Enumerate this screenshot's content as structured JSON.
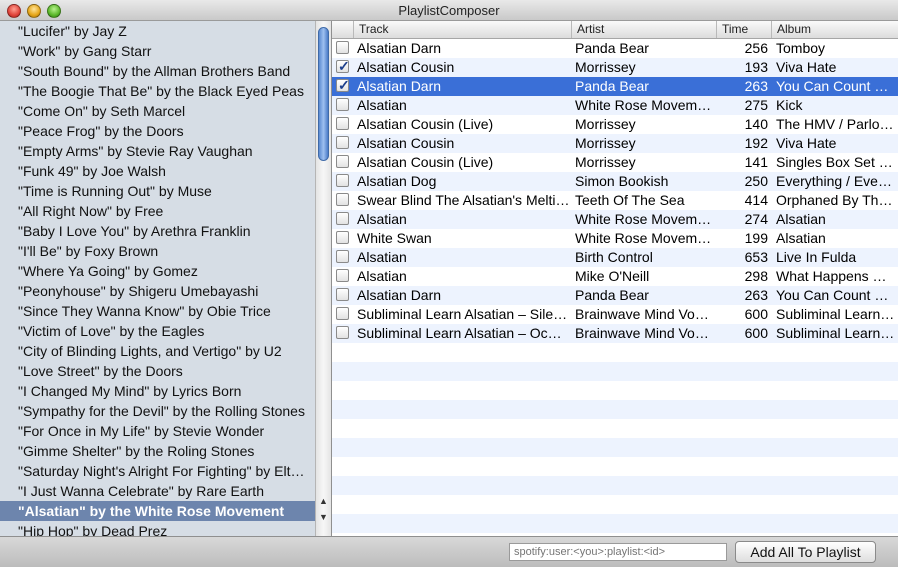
{
  "window": {
    "title": "PlaylistComposer"
  },
  "left_list": {
    "selected_index": 24,
    "items": [
      "\"Lucifer\" by Jay Z",
      "\"Work\" by Gang Starr",
      "\"South Bound\" by the Allman Brothers Band",
      "\"The Boogie That Be\" by the Black Eyed Peas",
      "\"Come On\" by Seth Marcel",
      "\"Peace Frog\" by the Doors",
      "\"Empty Arms\" by Stevie Ray Vaughan",
      "\"Funk 49\" by Joe Walsh",
      "\"Time is Running Out\" by Muse",
      "\"All Right Now\" by Free",
      "\"Baby I Love You\" by Arethra Franklin",
      "\"I'll Be\" by Foxy Brown",
      "\"Where Ya Going\" by Gomez",
      "\"Peonyhouse\" by Shigeru Umebayashi",
      "\"Since They Wanna Know\" by Obie Trice",
      "\"Victim of Love\" by the Eagles",
      "\"City of Blinding Lights, and Vertigo\" by U2",
      "\"Love Street\" by the Doors",
      "\"I Changed My Mind\" by Lyrics Born",
      "\"Sympathy for the Devil\" by the Rolling Stones",
      "\"For Once in My Life\" by Stevie Wonder",
      "\"Gimme Shelter\" by the Roling Stones",
      "\"Saturday Night's Alright For Fighting\" by Elt…",
      "\"I Just Wanna Celebrate\" by Rare Earth",
      "\"Alsatian\" by the White Rose Movement",
      "\"Hip Hop\" by Dead Prez"
    ]
  },
  "table": {
    "columns": {
      "track": "Track",
      "artist": "Artist",
      "time": "Time",
      "album": "Album"
    },
    "rows": [
      {
        "checked": false,
        "selected": false,
        "track": "Alsatian Darn",
        "artist": "Panda Bear",
        "time": "256",
        "album": "Tomboy"
      },
      {
        "checked": true,
        "selected": false,
        "track": "Alsatian Cousin",
        "artist": "Morrissey",
        "time": "193",
        "album": "Viva Hate"
      },
      {
        "checked": true,
        "selected": true,
        "track": "Alsatian Darn",
        "artist": "Panda Bear",
        "time": "263",
        "album": "You Can Count …"
      },
      {
        "checked": false,
        "selected": false,
        "track": "Alsatian",
        "artist": "White Rose Movement",
        "time": "275",
        "album": "Kick"
      },
      {
        "checked": false,
        "selected": false,
        "track": "Alsatian Cousin (Live)",
        "artist": "Morrissey",
        "time": "140",
        "album": "The HMV / Parlo…"
      },
      {
        "checked": false,
        "selected": false,
        "track": "Alsatian Cousin",
        "artist": "Morrissey",
        "time": "192",
        "album": "Viva Hate"
      },
      {
        "checked": false,
        "selected": false,
        "track": "Alsatian Cousin (Live)",
        "artist": "Morrissey",
        "time": "141",
        "album": "Singles Box Set …"
      },
      {
        "checked": false,
        "selected": false,
        "track": "Alsatian Dog",
        "artist": "Simon Bookish",
        "time": "250",
        "album": "Everything / Eve…"
      },
      {
        "checked": false,
        "selected": false,
        "track": "Swear Blind The Alsatian's Melting",
        "artist": "Teeth Of The Sea",
        "time": "414",
        "album": "Orphaned By Th…"
      },
      {
        "checked": false,
        "selected": false,
        "track": "Alsatian",
        "artist": "White Rose Movement",
        "time": "274",
        "album": "Alsatian"
      },
      {
        "checked": false,
        "selected": false,
        "track": "White Swan",
        "artist": "White Rose Movement",
        "time": "199",
        "album": "Alsatian"
      },
      {
        "checked": false,
        "selected": false,
        "track": "Alsatian",
        "artist": "Birth Control",
        "time": "653",
        "album": "Live In Fulda"
      },
      {
        "checked": false,
        "selected": false,
        "track": "Alsatian",
        "artist": "Mike O'Neill",
        "time": "298",
        "album": "What Happens N…"
      },
      {
        "checked": false,
        "selected": false,
        "track": "Alsatian Darn",
        "artist": "Panda Bear",
        "time": "263",
        "album": "You Can Count …"
      },
      {
        "checked": false,
        "selected": false,
        "track": "Subliminal Learn Alsatian – Sile…",
        "artist": "Brainwave Mind Vo…",
        "time": "600",
        "album": "Subliminal Learn…"
      },
      {
        "checked": false,
        "selected": false,
        "track": "Subliminal Learn Alsatian – Oc…",
        "artist": "Brainwave Mind Vo…",
        "time": "600",
        "album": "Subliminal Learn…"
      }
    ]
  },
  "bottom_bar": {
    "uri_placeholder": "spotify:user:<you>:playlist:<id>",
    "add_all_label": "Add All To Playlist"
  },
  "colors": {
    "selection": "#3a6fd7",
    "left_selection": "#6d85ad",
    "row_alt": "#edf3fe",
    "sidebar_bg": "#d6dde5"
  }
}
